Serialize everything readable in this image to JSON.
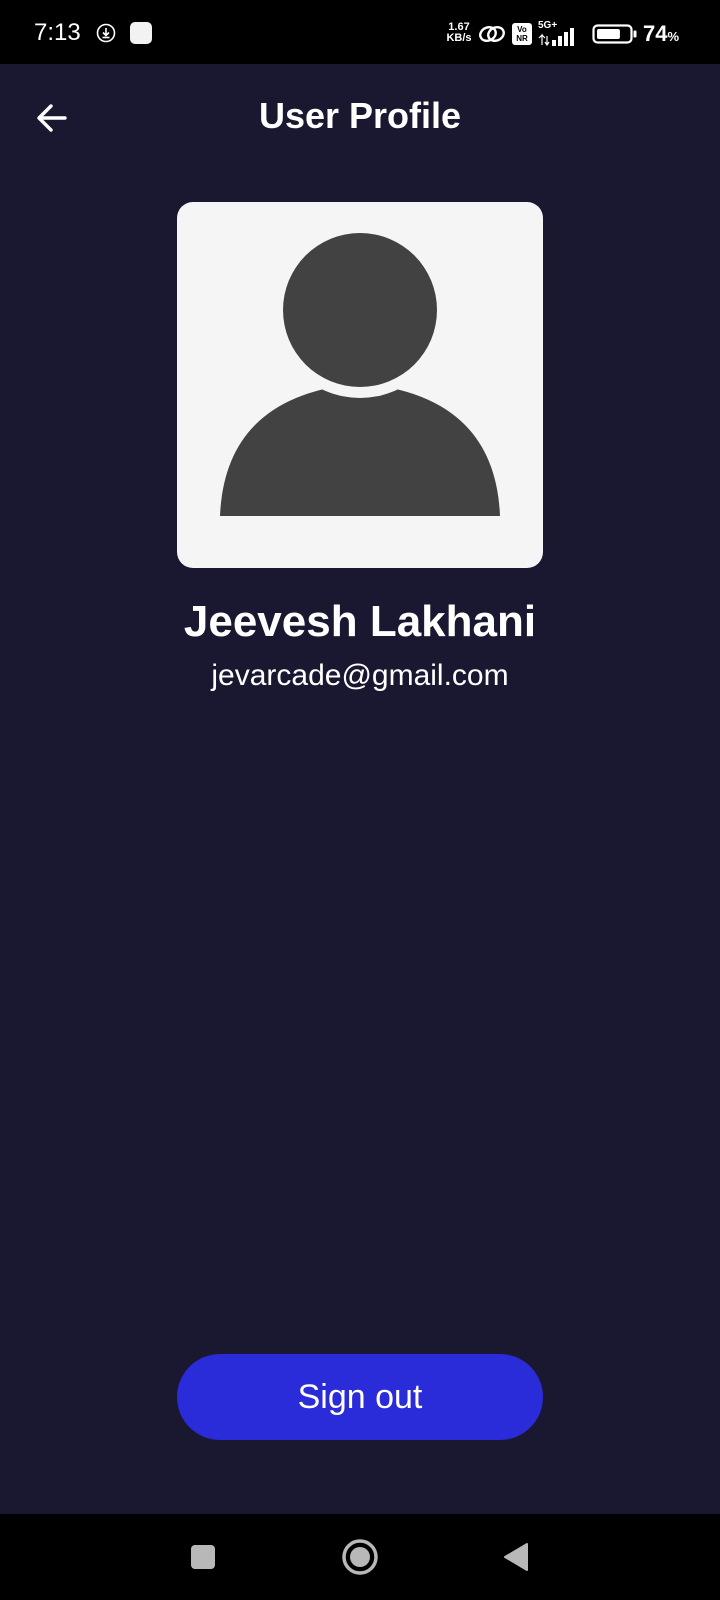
{
  "status_bar": {
    "time": "7:13",
    "net_speed_value": "1.67",
    "net_speed_unit": "KB/s",
    "volte_top": "Vo",
    "volte_bottom": "NR",
    "network_type": "5G+",
    "battery_value": "74",
    "battery_unit": "%",
    "battery_fraction": 0.74
  },
  "header": {
    "title": "User Profile",
    "back_icon": "arrow-left-icon"
  },
  "profile": {
    "avatar_icon": "person-silhouette-icon",
    "name": "Jeevesh Lakhani",
    "email": "jevarcade@gmail.com"
  },
  "actions": {
    "sign_out_label": "Sign out"
  },
  "nav_bar": {
    "recents_icon": "square-icon",
    "home_icon": "circle-icon",
    "back_icon": "triangle-back-icon"
  },
  "colors": {
    "background": "#1a1831",
    "status_bar": "#000000",
    "avatar_bg": "#f5f5f6",
    "avatar_fg": "#424242",
    "button": "#2a2bd9",
    "text": "#ffffff"
  }
}
